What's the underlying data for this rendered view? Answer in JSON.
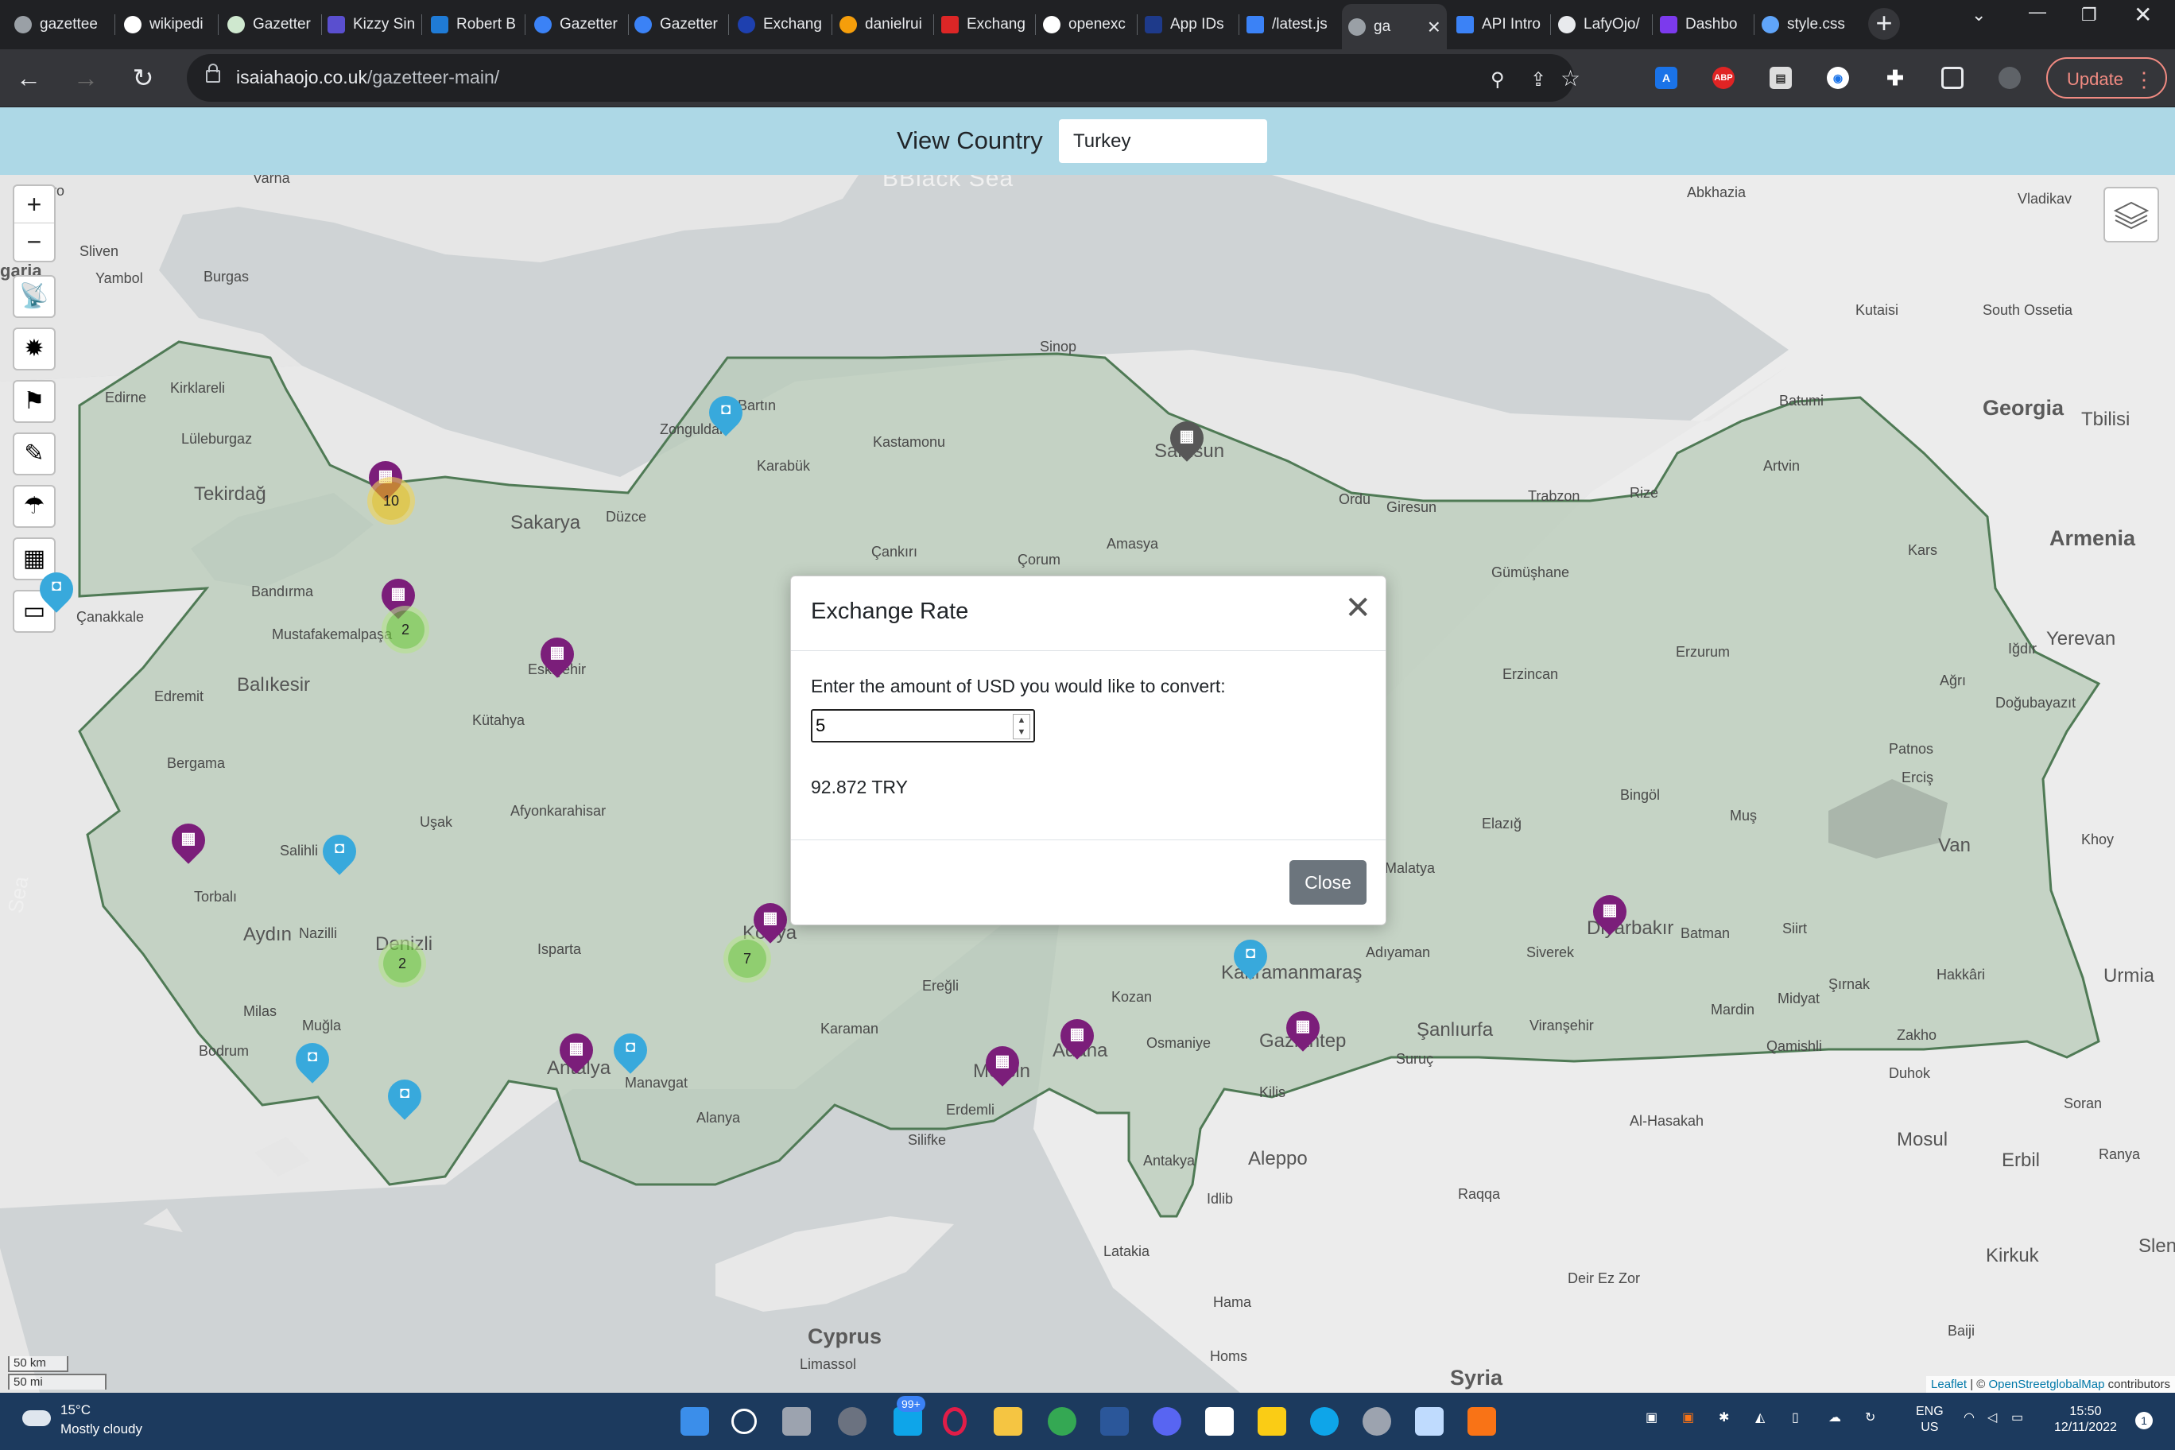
{
  "browser": {
    "tabs": [
      {
        "label": "gazettee"
      },
      {
        "label": "wikipedi"
      },
      {
        "label": "Gazetter"
      },
      {
        "label": "Kizzy Sin"
      },
      {
        "label": "Robert B"
      },
      {
        "label": "Gazetter"
      },
      {
        "label": "Gazetter"
      },
      {
        "label": "Exchang"
      },
      {
        "label": "danielrui"
      },
      {
        "label": "Exchang"
      },
      {
        "label": "openexc"
      },
      {
        "label": "App IDs"
      },
      {
        "label": "/latest.js"
      },
      {
        "label": "ga"
      },
      {
        "label": "API Intro"
      },
      {
        "label": "LafyOjo/"
      },
      {
        "label": "Dashbo"
      },
      {
        "label": "style.css"
      }
    ],
    "url_host": "isaiahaojo.co.uk",
    "url_path": "/gazetteer-main/",
    "update_label": "Update"
  },
  "header": {
    "label": "View Country",
    "selected_country": "Turkey"
  },
  "map": {
    "places": [
      {
        "name": "BBlack Sea"
      },
      {
        "name": "Abkhazia"
      },
      {
        "name": "Vladikav"
      },
      {
        "name": "Sliven"
      },
      {
        "name": "Yambol"
      },
      {
        "name": "Burgas"
      },
      {
        "name": "Edirne"
      },
      {
        "name": "Kirklareli"
      },
      {
        "name": "Lüleburgaz"
      },
      {
        "name": "Tekirdağ"
      },
      {
        "name": "Sakarya"
      },
      {
        "name": "Düzce"
      },
      {
        "name": "Zonguldak"
      },
      {
        "name": "Bartın"
      },
      {
        "name": "Karabük"
      },
      {
        "name": "Kastamonu"
      },
      {
        "name": "Sinop"
      },
      {
        "name": "Samsun"
      },
      {
        "name": "Ordu"
      },
      {
        "name": "Giresun"
      },
      {
        "name": "Trabzon"
      },
      {
        "name": "Rize"
      },
      {
        "name": "Batumi"
      },
      {
        "name": "Kutaisi"
      },
      {
        "name": "South Ossetia"
      },
      {
        "name": "Georgia"
      },
      {
        "name": "Tbilisi"
      },
      {
        "name": "Artvin"
      },
      {
        "name": "Armenia"
      },
      {
        "name": "Kars"
      },
      {
        "name": "Gümüşhane"
      },
      {
        "name": "Çankırı"
      },
      {
        "name": "Çorum"
      },
      {
        "name": "Amasya"
      },
      {
        "name": "Bandırma"
      },
      {
        "name": "Mustafakemalpaşa"
      },
      {
        "name": "Çanakkale"
      },
      {
        "name": "Balıkesir"
      },
      {
        "name": "Edremit"
      },
      {
        "name": "Kütahya"
      },
      {
        "name": "Eskişehir"
      },
      {
        "name": "Bergama"
      },
      {
        "name": "Afyonkarahisar"
      },
      {
        "name": "Uşak"
      },
      {
        "name": "Salihli"
      },
      {
        "name": "Torbalı"
      },
      {
        "name": "Aydın"
      },
      {
        "name": "Nazilli"
      },
      {
        "name": "Denizli"
      },
      {
        "name": "Isparta"
      },
      {
        "name": "Milas"
      },
      {
        "name": "Muğla"
      },
      {
        "name": "Bodrum"
      },
      {
        "name": "Antalya"
      },
      {
        "name": "Manavgat"
      },
      {
        "name": "Alanya"
      },
      {
        "name": "Karaman"
      },
      {
        "name": "Ereğli"
      },
      {
        "name": "Konya"
      },
      {
        "name": "Erzincan"
      },
      {
        "name": "Erzurum"
      },
      {
        "name": "Iğdır"
      },
      {
        "name": "Yerevan"
      },
      {
        "name": "Ağrı"
      },
      {
        "name": "Doğubayazıt"
      },
      {
        "name": "Patnos"
      },
      {
        "name": "Erciş"
      },
      {
        "name": "Bingöl"
      },
      {
        "name": "Muş"
      },
      {
        "name": "Elazığ"
      },
      {
        "name": "Malatya"
      },
      {
        "name": "Van"
      },
      {
        "name": "Khoy"
      },
      {
        "name": "Diyarbakır"
      },
      {
        "name": "Batman"
      },
      {
        "name": "Siirt"
      },
      {
        "name": "Şırnak"
      },
      {
        "name": "Hakkâri"
      },
      {
        "name": "Urmia"
      },
      {
        "name": "Adıyaman"
      },
      {
        "name": "Siverek"
      },
      {
        "name": "Kahramanmaraş"
      },
      {
        "name": "Kozan"
      },
      {
        "name": "Osmaniye"
      },
      {
        "name": "Adana"
      },
      {
        "name": "Mersin"
      },
      {
        "name": "Erdemli"
      },
      {
        "name": "Silifke"
      },
      {
        "name": "Gaziantep"
      },
      {
        "name": "Şanlıurfa"
      },
      {
        "name": "Viranşehir"
      },
      {
        "name": "Mardin"
      },
      {
        "name": "Midyat"
      },
      {
        "name": "Qamishli"
      },
      {
        "name": "Zakho"
      },
      {
        "name": "Duhok"
      },
      {
        "name": "Soran"
      },
      {
        "name": "Suruç"
      },
      {
        "name": "Kilis"
      },
      {
        "name": "Aleppo"
      },
      {
        "name": "Antakya"
      },
      {
        "name": "Idlib"
      },
      {
        "name": "Raqqa"
      },
      {
        "name": "Al-Hasakah"
      },
      {
        "name": "Mosul"
      },
      {
        "name": "Erbil"
      },
      {
        "name": "Ranya"
      },
      {
        "name": "Kirkuk"
      },
      {
        "name": "Latakia"
      },
      {
        "name": "Hama"
      },
      {
        "name": "Homs"
      },
      {
        "name": "Deir Ez Zor"
      },
      {
        "name": "Cyprus"
      },
      {
        "name": "Limassol"
      },
      {
        "name": "Syria"
      },
      {
        "name": "Baiji"
      },
      {
        "name": "Sea"
      },
      {
        "name": "garia"
      },
      {
        "name": "ovo"
      },
      {
        "name": "Varna"
      },
      {
        "name": "Slen"
      }
    ],
    "clusters": [
      {
        "count": "2"
      },
      {
        "count": "2"
      },
      {
        "count": "7"
      },
      {
        "count": "10"
      }
    ],
    "scale_km": "50 km",
    "scale_mi": "50 mi",
    "attribution_leaflet": "Leaflet",
    "attribution_osm": "OpenStreetglobalMap",
    "attribution_suffix": "contributors",
    "colors": {
      "country_fill": "#b8cbb8",
      "country_border": "#4f7a55",
      "marker_purple": "#7b1e7a",
      "marker_blue": "#38a9dc",
      "marker_dark": "#575757"
    }
  },
  "modal": {
    "title": "Exchange Rate",
    "prompt": "Enter the amount of USD you would like to convert:",
    "amount_value": "5",
    "result": "92.872 TRY",
    "close_label": "Close"
  },
  "taskbar": {
    "temperature": "15°C",
    "weather": "Mostly cloudy",
    "lang": "ENG",
    "region": "US",
    "time": "15:50",
    "date": "12/11/2022",
    "mail_badge": "99+",
    "notification_count": "1"
  }
}
